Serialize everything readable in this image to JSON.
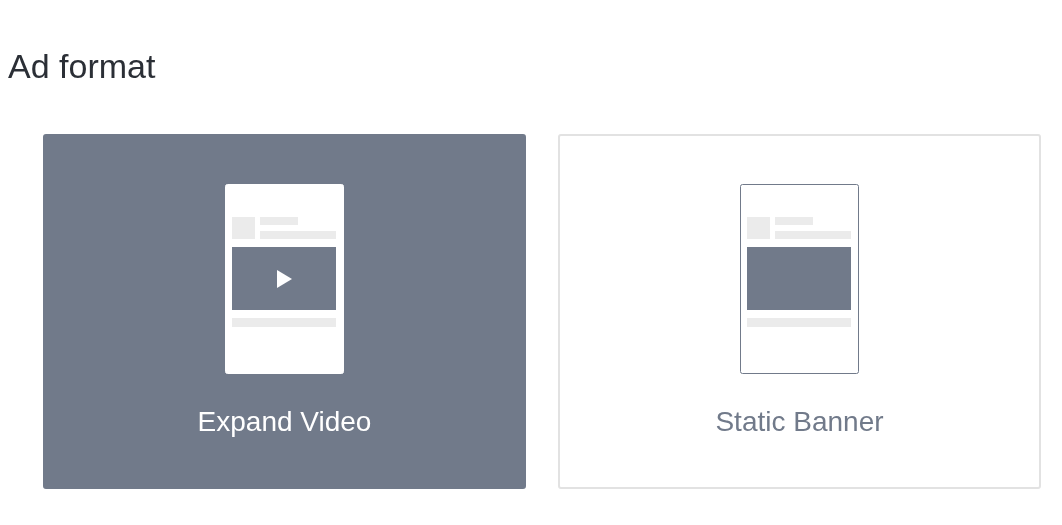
{
  "title": "Ad format",
  "options": [
    {
      "label": "Expand Video",
      "kind": "video",
      "selected": true
    },
    {
      "label": "Static Banner",
      "kind": "banner",
      "selected": false
    }
  ]
}
